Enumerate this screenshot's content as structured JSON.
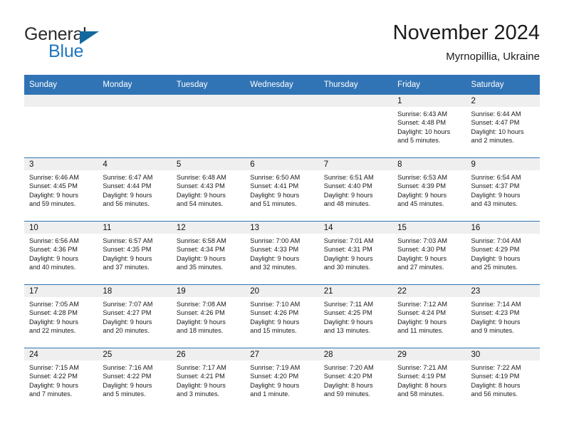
{
  "brand": {
    "word_one": "General",
    "word_two": "Blue",
    "triangle_icon": "triangle-icon"
  },
  "header": {
    "title": "November 2024",
    "subtitle": "Myrnopillia, Ukraine"
  },
  "colors": {
    "header_blue": "#3174b5",
    "daynum_band": "#efefef",
    "brand_blue": "#1f76bd",
    "brand_dark": "#2b2b2b"
  },
  "calendar": {
    "weekday_headers": [
      "Sunday",
      "Monday",
      "Tuesday",
      "Wednesday",
      "Thursday",
      "Friday",
      "Saturday"
    ],
    "weeks": [
      [
        {
          "day": "",
          "lines": []
        },
        {
          "day": "",
          "lines": []
        },
        {
          "day": "",
          "lines": []
        },
        {
          "day": "",
          "lines": []
        },
        {
          "day": "",
          "lines": []
        },
        {
          "day": "1",
          "lines": [
            "Sunrise: 6:43 AM",
            "Sunset: 4:48 PM",
            "Daylight: 10 hours",
            "and 5 minutes."
          ]
        },
        {
          "day": "2",
          "lines": [
            "Sunrise: 6:44 AM",
            "Sunset: 4:47 PM",
            "Daylight: 10 hours",
            "and 2 minutes."
          ]
        }
      ],
      [
        {
          "day": "3",
          "lines": [
            "Sunrise: 6:46 AM",
            "Sunset: 4:45 PM",
            "Daylight: 9 hours",
            "and 59 minutes."
          ]
        },
        {
          "day": "4",
          "lines": [
            "Sunrise: 6:47 AM",
            "Sunset: 4:44 PM",
            "Daylight: 9 hours",
            "and 56 minutes."
          ]
        },
        {
          "day": "5",
          "lines": [
            "Sunrise: 6:48 AM",
            "Sunset: 4:43 PM",
            "Daylight: 9 hours",
            "and 54 minutes."
          ]
        },
        {
          "day": "6",
          "lines": [
            "Sunrise: 6:50 AM",
            "Sunset: 4:41 PM",
            "Daylight: 9 hours",
            "and 51 minutes."
          ]
        },
        {
          "day": "7",
          "lines": [
            "Sunrise: 6:51 AM",
            "Sunset: 4:40 PM",
            "Daylight: 9 hours",
            "and 48 minutes."
          ]
        },
        {
          "day": "8",
          "lines": [
            "Sunrise: 6:53 AM",
            "Sunset: 4:39 PM",
            "Daylight: 9 hours",
            "and 45 minutes."
          ]
        },
        {
          "day": "9",
          "lines": [
            "Sunrise: 6:54 AM",
            "Sunset: 4:37 PM",
            "Daylight: 9 hours",
            "and 43 minutes."
          ]
        }
      ],
      [
        {
          "day": "10",
          "lines": [
            "Sunrise: 6:56 AM",
            "Sunset: 4:36 PM",
            "Daylight: 9 hours",
            "and 40 minutes."
          ]
        },
        {
          "day": "11",
          "lines": [
            "Sunrise: 6:57 AM",
            "Sunset: 4:35 PM",
            "Daylight: 9 hours",
            "and 37 minutes."
          ]
        },
        {
          "day": "12",
          "lines": [
            "Sunrise: 6:58 AM",
            "Sunset: 4:34 PM",
            "Daylight: 9 hours",
            "and 35 minutes."
          ]
        },
        {
          "day": "13",
          "lines": [
            "Sunrise: 7:00 AM",
            "Sunset: 4:33 PM",
            "Daylight: 9 hours",
            "and 32 minutes."
          ]
        },
        {
          "day": "14",
          "lines": [
            "Sunrise: 7:01 AM",
            "Sunset: 4:31 PM",
            "Daylight: 9 hours",
            "and 30 minutes."
          ]
        },
        {
          "day": "15",
          "lines": [
            "Sunrise: 7:03 AM",
            "Sunset: 4:30 PM",
            "Daylight: 9 hours",
            "and 27 minutes."
          ]
        },
        {
          "day": "16",
          "lines": [
            "Sunrise: 7:04 AM",
            "Sunset: 4:29 PM",
            "Daylight: 9 hours",
            "and 25 minutes."
          ]
        }
      ],
      [
        {
          "day": "17",
          "lines": [
            "Sunrise: 7:05 AM",
            "Sunset: 4:28 PM",
            "Daylight: 9 hours",
            "and 22 minutes."
          ]
        },
        {
          "day": "18",
          "lines": [
            "Sunrise: 7:07 AM",
            "Sunset: 4:27 PM",
            "Daylight: 9 hours",
            "and 20 minutes."
          ]
        },
        {
          "day": "19",
          "lines": [
            "Sunrise: 7:08 AM",
            "Sunset: 4:26 PM",
            "Daylight: 9 hours",
            "and 18 minutes."
          ]
        },
        {
          "day": "20",
          "lines": [
            "Sunrise: 7:10 AM",
            "Sunset: 4:26 PM",
            "Daylight: 9 hours",
            "and 15 minutes."
          ]
        },
        {
          "day": "21",
          "lines": [
            "Sunrise: 7:11 AM",
            "Sunset: 4:25 PM",
            "Daylight: 9 hours",
            "and 13 minutes."
          ]
        },
        {
          "day": "22",
          "lines": [
            "Sunrise: 7:12 AM",
            "Sunset: 4:24 PM",
            "Daylight: 9 hours",
            "and 11 minutes."
          ]
        },
        {
          "day": "23",
          "lines": [
            "Sunrise: 7:14 AM",
            "Sunset: 4:23 PM",
            "Daylight: 9 hours",
            "and 9 minutes."
          ]
        }
      ],
      [
        {
          "day": "24",
          "lines": [
            "Sunrise: 7:15 AM",
            "Sunset: 4:22 PM",
            "Daylight: 9 hours",
            "and 7 minutes."
          ]
        },
        {
          "day": "25",
          "lines": [
            "Sunrise: 7:16 AM",
            "Sunset: 4:22 PM",
            "Daylight: 9 hours",
            "and 5 minutes."
          ]
        },
        {
          "day": "26",
          "lines": [
            "Sunrise: 7:17 AM",
            "Sunset: 4:21 PM",
            "Daylight: 9 hours",
            "and 3 minutes."
          ]
        },
        {
          "day": "27",
          "lines": [
            "Sunrise: 7:19 AM",
            "Sunset: 4:20 PM",
            "Daylight: 9 hours",
            "and 1 minute."
          ]
        },
        {
          "day": "28",
          "lines": [
            "Sunrise: 7:20 AM",
            "Sunset: 4:20 PM",
            "Daylight: 8 hours",
            "and 59 minutes."
          ]
        },
        {
          "day": "29",
          "lines": [
            "Sunrise: 7:21 AM",
            "Sunset: 4:19 PM",
            "Daylight: 8 hours",
            "and 58 minutes."
          ]
        },
        {
          "day": "30",
          "lines": [
            "Sunrise: 7:22 AM",
            "Sunset: 4:19 PM",
            "Daylight: 8 hours",
            "and 56 minutes."
          ]
        }
      ]
    ]
  }
}
